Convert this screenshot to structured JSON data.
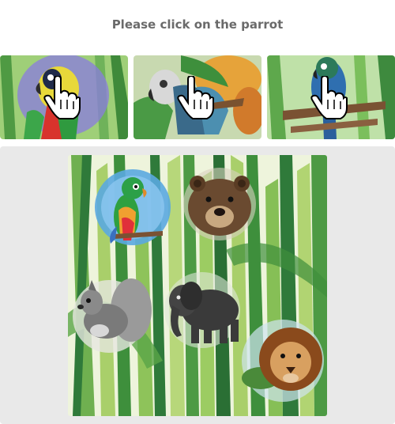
{
  "prompt": "Please click on the parrot",
  "examples": [
    {
      "subject": "parrot",
      "icon": "hand-pointer-icon"
    },
    {
      "subject": "parrot",
      "icon": "hand-pointer-icon"
    },
    {
      "subject": "parrot",
      "icon": "hand-pointer-icon"
    }
  ],
  "challenge": {
    "background": "watercolor-grass",
    "animals": [
      "parrot",
      "bear",
      "squirrel",
      "elephant",
      "lion"
    ]
  },
  "colors": {
    "prompt_text": "#6a6a6a",
    "stage_bg": "#e9e9e9",
    "grass_light": "#a9cf6a",
    "grass_dark": "#2f7a3a"
  }
}
